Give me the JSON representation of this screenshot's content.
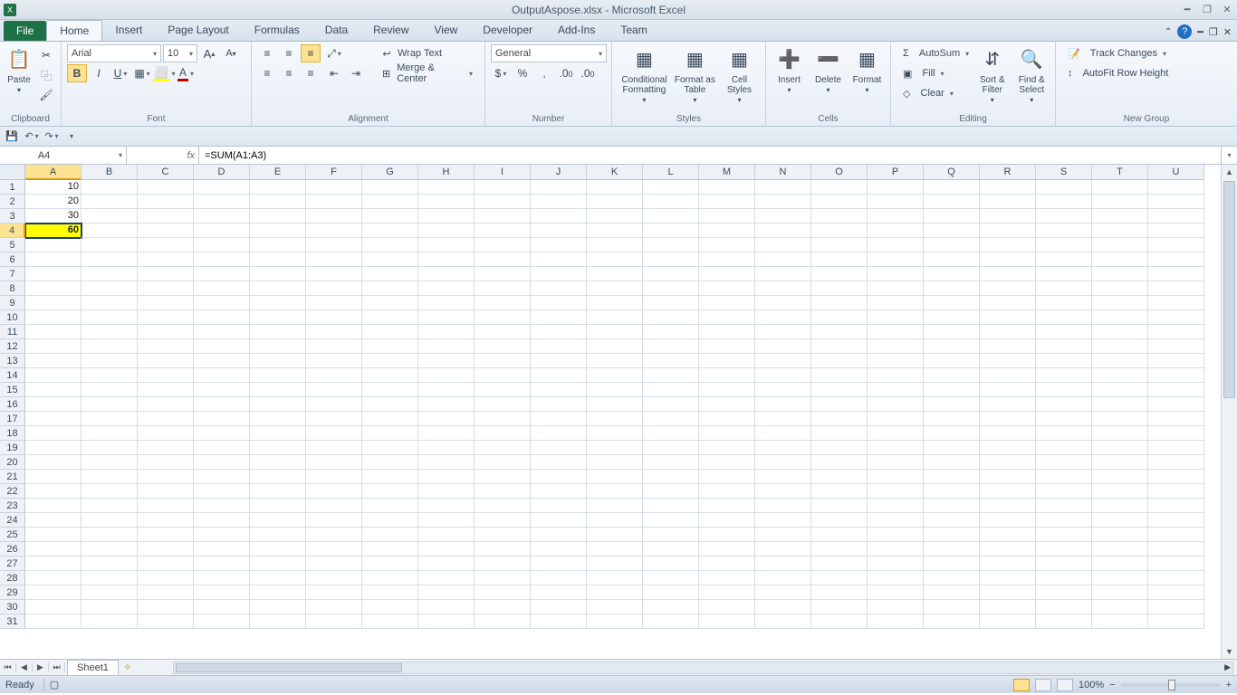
{
  "title": "OutputAspose.xlsx - Microsoft Excel",
  "tabs": {
    "file": "File",
    "items": [
      "Home",
      "Insert",
      "Page Layout",
      "Formulas",
      "Data",
      "Review",
      "View",
      "Developer",
      "Add-Ins",
      "Team"
    ],
    "active": "Home"
  },
  "ribbon": {
    "clipboard": {
      "label": "Clipboard",
      "paste": "Paste"
    },
    "font": {
      "label": "Font",
      "name": "Arial",
      "size": "10"
    },
    "alignment": {
      "label": "Alignment",
      "wrap": "Wrap Text",
      "merge": "Merge & Center"
    },
    "number": {
      "label": "Number",
      "format": "General"
    },
    "styles": {
      "label": "Styles",
      "cond": "Conditional Formatting",
      "table": "Format as Table",
      "cell": "Cell Styles"
    },
    "cells": {
      "label": "Cells",
      "insert": "Insert",
      "delete": "Delete",
      "format": "Format"
    },
    "editing": {
      "label": "Editing",
      "autosum": "AutoSum",
      "fill": "Fill",
      "clear": "Clear",
      "sort": "Sort & Filter",
      "find": "Find & Select"
    },
    "newgroup": {
      "label": "New Group",
      "track": "Track Changes",
      "autofit": "AutoFit Row Height"
    }
  },
  "formula_bar": {
    "cell_ref": "A4",
    "formula": "=SUM(A1:A3)"
  },
  "columns": [
    "A",
    "B",
    "C",
    "D",
    "E",
    "F",
    "G",
    "H",
    "I",
    "J",
    "K",
    "L",
    "M",
    "N",
    "O",
    "P",
    "Q",
    "R",
    "S",
    "T",
    "U"
  ],
  "rows": 31,
  "selected_row": 4,
  "selected_col": "A",
  "cell_values": {
    "A1": "10",
    "A2": "20",
    "A3": "30",
    "A4": "60"
  },
  "sheet": {
    "name": "Sheet1"
  },
  "status": {
    "ready": "Ready",
    "zoom": "100%"
  }
}
